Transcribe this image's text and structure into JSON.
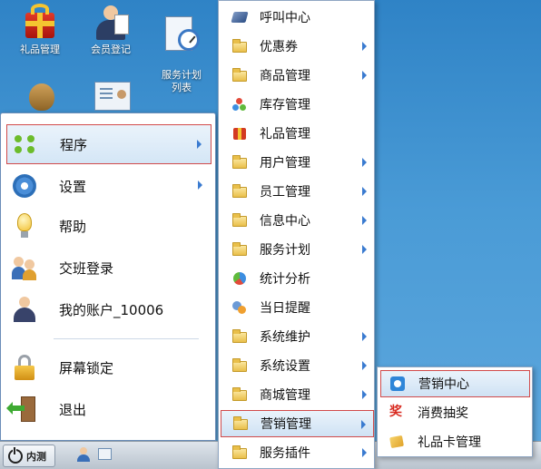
{
  "desktop": {
    "icons": [
      {
        "label": "礼品管理",
        "icon": "gift-icon"
      },
      {
        "label": "会员登记",
        "icon": "member-icon"
      },
      {
        "label": "服务计划\n列表",
        "icon": "service-plan-icon"
      },
      {
        "label": "",
        "icon": "money-bag-icon"
      },
      {
        "label": "",
        "icon": "member-card-icon"
      }
    ]
  },
  "start_menu": {
    "items": [
      {
        "label": "程序",
        "icon": "programs-grid-icon",
        "has_submenu": true,
        "active": true
      },
      {
        "label": "设置",
        "icon": "gear-icon",
        "has_submenu": true
      },
      {
        "label": "帮助",
        "icon": "bulb-icon",
        "has_submenu": false
      },
      {
        "label": "交班登录",
        "icon": "shift-users-icon",
        "has_submenu": false
      },
      {
        "label": "我的账户_10006",
        "icon": "account-icon",
        "has_submenu": false
      },
      {
        "label": "屏幕锁定",
        "icon": "lock-icon",
        "has_submenu": false
      },
      {
        "label": "退出",
        "icon": "exit-icon",
        "has_submenu": false
      }
    ]
  },
  "program_menu": {
    "items": [
      {
        "label": "呼叫中心",
        "icon": "call-center-icon",
        "has_submenu": false
      },
      {
        "label": "优惠券",
        "icon": "folder-icon",
        "has_submenu": true
      },
      {
        "label": "商品管理",
        "icon": "folder-icon",
        "has_submenu": true
      },
      {
        "label": "库存管理",
        "icon": "stock-icon",
        "has_submenu": false
      },
      {
        "label": "礼品管理",
        "icon": "gift-icon",
        "has_submenu": false
      },
      {
        "label": "用户管理",
        "icon": "folder-icon",
        "has_submenu": true
      },
      {
        "label": "员工管理",
        "icon": "folder-icon",
        "has_submenu": true
      },
      {
        "label": "信息中心",
        "icon": "folder-icon",
        "has_submenu": true
      },
      {
        "label": "服务计划",
        "icon": "folder-icon",
        "has_submenu": true
      },
      {
        "label": "统计分析",
        "icon": "statistics-icon",
        "has_submenu": false
      },
      {
        "label": "当日提醒",
        "icon": "reminder-icon",
        "has_submenu": false
      },
      {
        "label": "系统维护",
        "icon": "folder-icon",
        "has_submenu": true
      },
      {
        "label": "系统设置",
        "icon": "folder-icon",
        "has_submenu": true
      },
      {
        "label": "商城管理",
        "icon": "folder-icon",
        "has_submenu": true
      },
      {
        "label": "营销管理",
        "icon": "folder-icon",
        "has_submenu": true,
        "active": true
      },
      {
        "label": "服务插件",
        "icon": "folder-icon",
        "has_submenu": true
      }
    ]
  },
  "marketing_submenu": {
    "items": [
      {
        "label": "营销中心",
        "icon": "marketing-center-icon",
        "active": true
      },
      {
        "label": "消费抽奖",
        "icon": "lottery-icon"
      },
      {
        "label": "礼品卡管理",
        "icon": "gift-card-icon"
      }
    ],
    "lottery_glyph": "奖"
  },
  "taskbar": {
    "start_label": "内测"
  },
  "colors": {
    "desktop_top": "#2f83c6",
    "highlight_border": "#d14a4a",
    "highlight_fill": "#d4e6f6",
    "arrow": "#3a7bd0"
  }
}
